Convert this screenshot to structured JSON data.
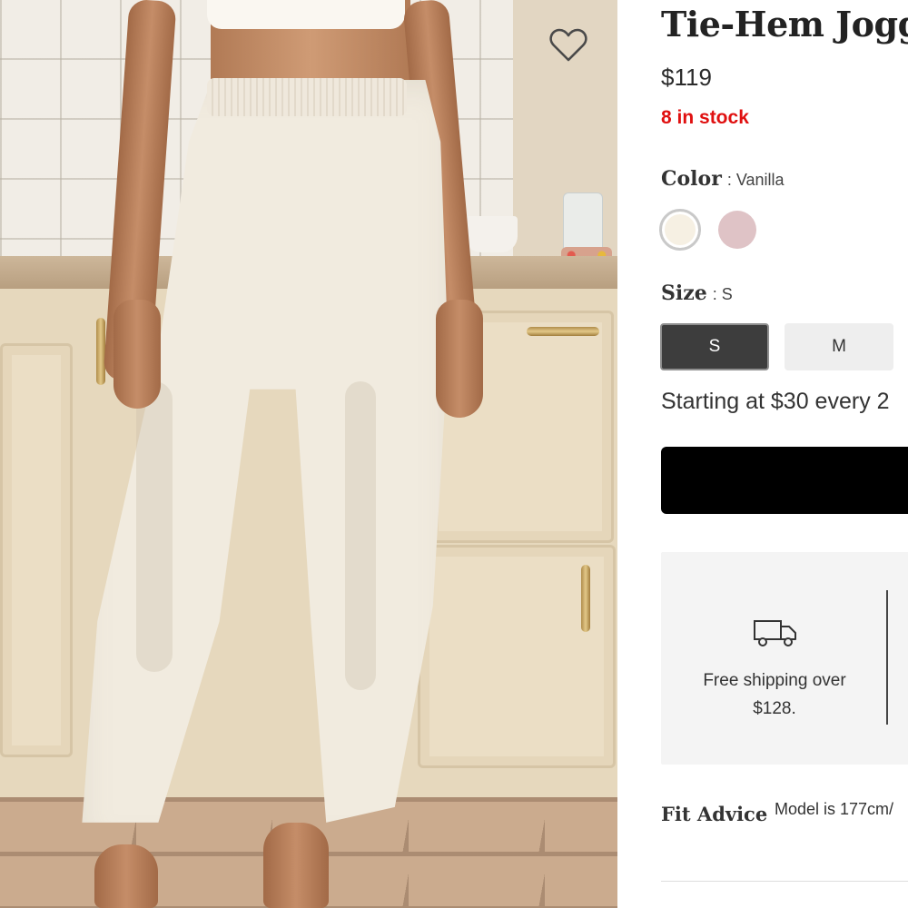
{
  "product": {
    "title": "Tie-Hem Jogge",
    "price": "$119",
    "stock": "8 in stock"
  },
  "color": {
    "label": "Color",
    "value": ": Vanilla",
    "swatches": [
      {
        "name": "Vanilla",
        "hex": "#f6f0e3",
        "selected": true
      },
      {
        "name": "Pink",
        "hex": "#dfc3c6",
        "selected": false
      }
    ]
  },
  "size": {
    "label": "Size",
    "value": ": S",
    "options": [
      "S",
      "M"
    ],
    "selected": "S"
  },
  "installment_text": "Starting at $30 every 2",
  "shipping": {
    "icon": "truck-icon",
    "line1": "Free shipping over",
    "line2": "$128."
  },
  "fit_advice": {
    "label": "Fit Advice",
    "text": "Model is 177cm/"
  },
  "icons": {
    "favorite": "heart-icon"
  },
  "colors": {
    "stock_red": "#e01010",
    "selected_size_bg": "#3d3d3d",
    "cta_bg": "#000000"
  }
}
